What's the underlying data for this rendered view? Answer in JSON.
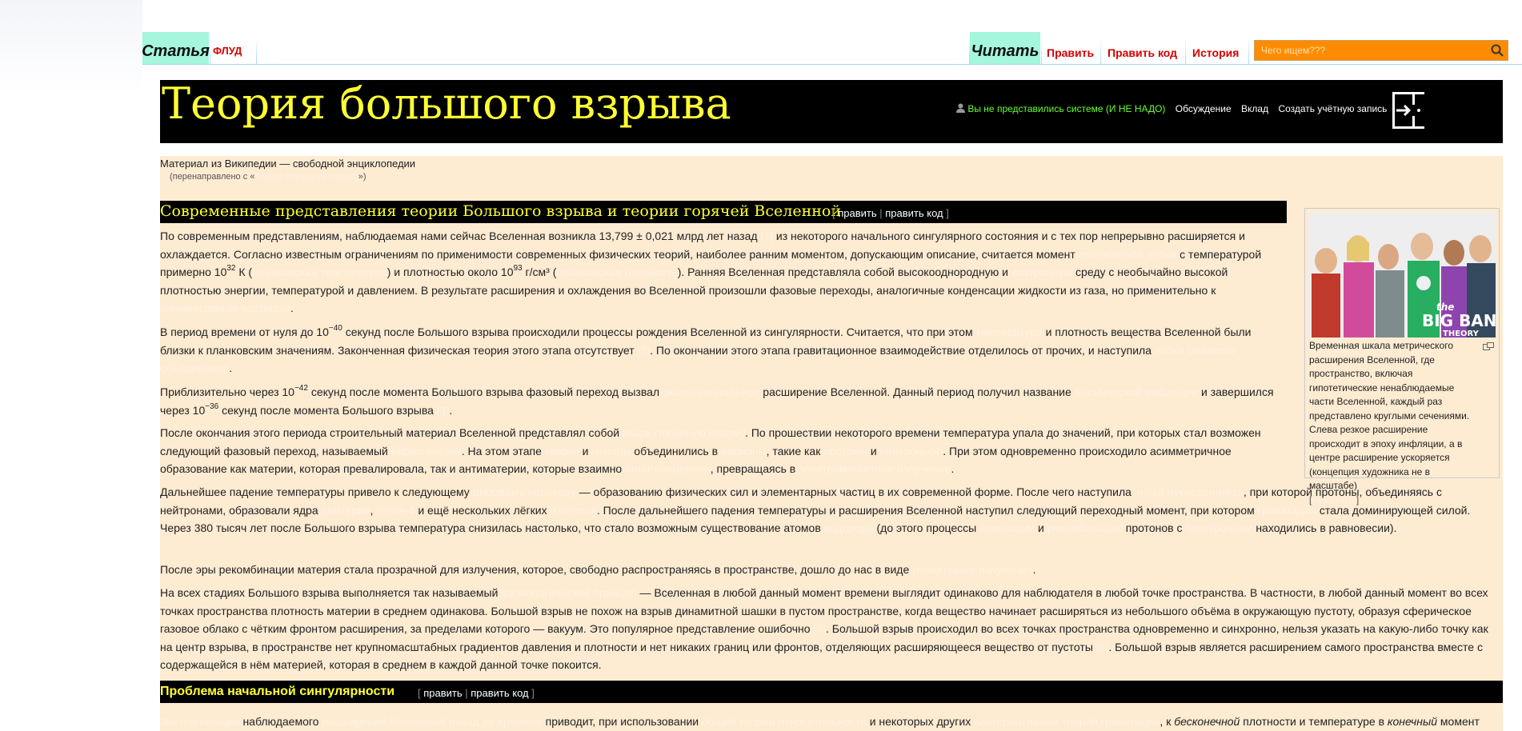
{
  "tabs": {
    "article": "Статья",
    "flood": "ФЛУД",
    "read": "Читать",
    "edit": "Править",
    "edit_code": "Править код",
    "history": "История"
  },
  "search": {
    "placeholder": "Чего ищем???"
  },
  "header": {
    "title": "Теория большого взрыва",
    "anon_text": "Вы не представились системе (И НЕ НАДО)",
    "links": [
      "Обсуждение",
      "Вклад",
      "Создать учётную запись"
    ]
  },
  "content": {
    "site_sub": "Материал из Википедии — свободной энциклопедии",
    "redirect_prefix": "(перенаправлено с «",
    "redirect_link": "Теория Большого взрыва",
    "redirect_suffix": "»)",
    "section1": {
      "title": "Современные представления теории Большого взрыва и теории горячей Вселенной",
      "edit": "править",
      "edit_code": "править код"
    },
    "section2": {
      "title": "Проблема начальной сингулярности",
      "edit": "править",
      "edit_code": "править код"
    }
  },
  "figure": {
    "image_text": "the BIG BANG THEORY",
    "caption": "Временная шкала метрического расширения Вселенной, где пространство, включая гипотетические ненаблюдаемые части Вселенной, каждый раз представлено круглыми сечениями. Слева резкое расширение происходит в эпоху инфляции, а в центре расширение ускоряется (концепция художника не в масштабе)",
    "caption_link": "[показать]"
  },
  "icons": {
    "search": "magnifier-icon",
    "user": "user-icon",
    "logo": "exit-door-icon",
    "magnify": "enlarge-icon"
  },
  "colors": {
    "tab_bg": "#a4f6dd",
    "action_red": "#d40000",
    "search_orange": "#ff8c00",
    "title_yellow": "#ffff33",
    "content_bg": "#fdebd2",
    "anon_green": "#66ff33"
  }
}
